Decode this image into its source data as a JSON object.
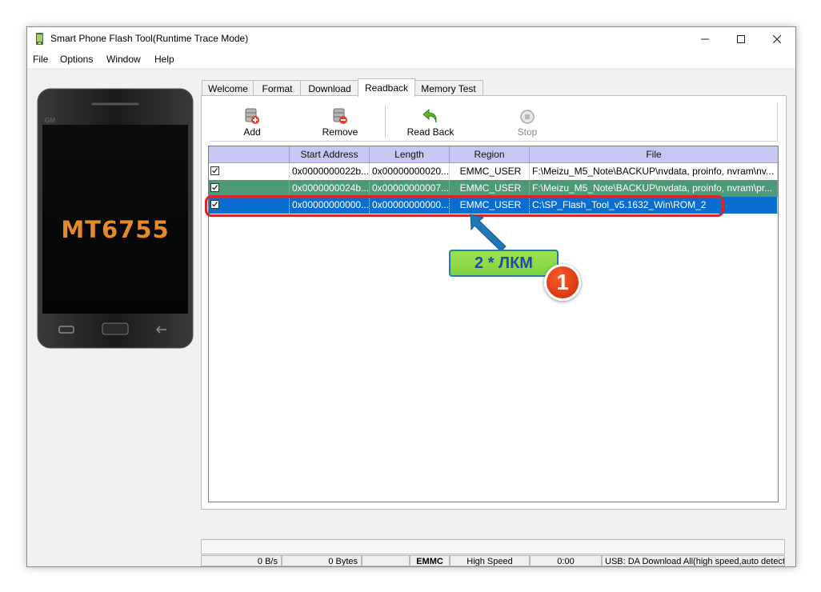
{
  "window": {
    "title": "Smart Phone Flash Tool(Runtime Trace Mode)",
    "controls": [
      "minimize-icon",
      "maximize-icon",
      "close-icon"
    ]
  },
  "menu": [
    "File",
    "Options",
    "Window",
    "Help"
  ],
  "phone": {
    "chip": "MT6755",
    "bezel_text": "GM"
  },
  "tabs": [
    "Welcome",
    "Format",
    "Download",
    "Readback",
    "Memory Test"
  ],
  "active_tab": "Readback",
  "toolbar": {
    "add": "Add",
    "remove": "Remove",
    "read_back": "Read Back",
    "stop": "Stop"
  },
  "table": {
    "columns": [
      "Start Address",
      "Length",
      "Region",
      "File"
    ],
    "rows": [
      {
        "checked": true,
        "start": "0x0000000022b...",
        "length": "0x00000000020...",
        "region": "EMMC_USER",
        "file": "F:\\Meizu_M5_Note\\BACKUP\\nvdata, proinfo, nvram\\nv..."
      },
      {
        "checked": true,
        "start": "0x0000000024b...",
        "length": "0x00000000007...",
        "region": "EMMC_USER",
        "file": "F:\\Meizu_M5_Note\\BACKUP\\nvdata, proinfo, nvram\\pr..."
      },
      {
        "checked": true,
        "start": "0x00000000000...",
        "length": "0x00000000000...",
        "region": "EMMC_USER",
        "file": "C:\\SP_Flash_Tool_v5.1632_Win\\ROM_2"
      }
    ]
  },
  "statusbar": {
    "speed": "0 B/s",
    "bytes": "0 Bytes",
    "storage": "EMMC",
    "mode": "High Speed",
    "time": "0:00",
    "usb": "USB: DA Download All(high speed,auto detect)"
  },
  "annotation": {
    "hint": "2 * ЛКМ",
    "step": "1"
  },
  "colors": {
    "header": "#c7c7f4",
    "row_green": "#4c9a76",
    "row_selected": "#0a6ed1",
    "highlight": "#d9262b"
  }
}
